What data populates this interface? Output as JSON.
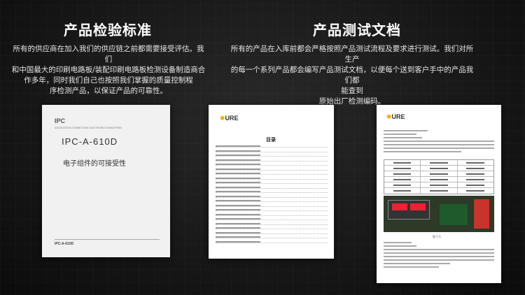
{
  "left": {
    "title": "产品检验标准",
    "paragraph": [
      "所有的供应商在加入我们的供应链之前都需要接受评估。我们",
      "和中国最大的印刷电路板/装配印刷电路板检测设备制造商合",
      "作多年，同时我们自己也按照我们掌握的质量控制程",
      "序检测产品，以保证产品的可靠性。"
    ],
    "document": {
      "logo": "IPC",
      "logo_sub": "ASSOCIATION CONNECTING ELECTRONICS INDUSTRIES",
      "title": "IPC-A-610D",
      "subtitle_cn": "电子组件的可接受性",
      "footer_title": "IPC-A-610D"
    }
  },
  "right": {
    "title": "产品测试文档",
    "paragraph": [
      "所有的产品在入库前都会严格按照产品测试流程及要求进行测试。我们对所生产",
      "的每一个系列产品都会编写产品测试文档，以便每个送到客户手中的产品我们都",
      "能查到",
      "原始出厂检测编码。"
    ],
    "doc_toc": {
      "logo": "URE",
      "heading": "目录"
    },
    "doc_test": {
      "logo": "URE",
      "caption": "图 1-1"
    }
  }
}
